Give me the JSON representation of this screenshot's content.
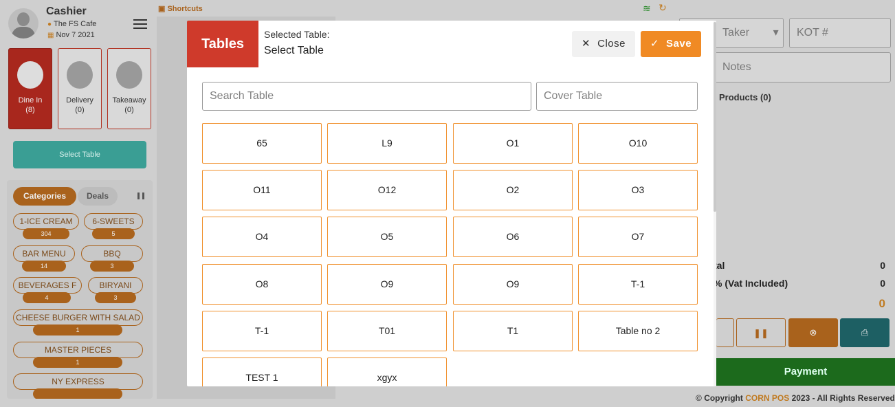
{
  "cashier": {
    "name": "Cashier",
    "location": "The FS Cafe",
    "date": "Nov 7 2021"
  },
  "order_types": [
    {
      "label": "Dine In",
      "count": "(8)"
    },
    {
      "label": "Delivery",
      "count": "(0)"
    },
    {
      "label": "Takeaway",
      "count": "(0)"
    }
  ],
  "select_table_label": "Select Table",
  "category_tabs": {
    "categories": "Categories",
    "deals": "Deals"
  },
  "categories": [
    {
      "name": "1-ICE CREAM",
      "count": "304"
    },
    {
      "name": "6-SWEETS",
      "count": "5"
    },
    {
      "name": "BAR MENU",
      "count": "14"
    },
    {
      "name": "BBQ",
      "count": "3"
    },
    {
      "name": "BEVERAGES F",
      "count": "4"
    },
    {
      "name": "BIRYANI",
      "count": "3"
    },
    {
      "name": "CHEESE BURGER WITH SALAD",
      "count": "1"
    },
    {
      "name": "MASTER PIECES",
      "count": "1"
    },
    {
      "name": "NY EXPRESS",
      "count": ""
    }
  ],
  "shortcuts_label": "Shortcuts",
  "right_panel": {
    "taker": "Taker",
    "kot_placeholder": "KOT #",
    "notes": "Notes",
    "products": "Products (0)",
    "totals": [
      {
        "label": "tal",
        "value": "0"
      },
      {
        "label": "% (Vat Included)",
        "value": "0"
      },
      {
        "label": "",
        "value": "0"
      }
    ],
    "payment": "Payment",
    "copyright_prefix": "Copyright",
    "copyright_brand": "CORN POS",
    "copyright_suffix": "2023 - All Rights Reserved"
  },
  "modal": {
    "title": "Tables",
    "selected_label": "Selected Table:",
    "selected_value": "Select Table",
    "close": "Close",
    "save": "Save",
    "search_placeholder": "Search Table",
    "cover_placeholder": "Cover Table",
    "tables": [
      "65",
      "L9",
      "O1",
      "O10",
      "O11",
      "O12",
      "O2",
      "O3",
      "O4",
      "O5",
      "O6",
      "O7",
      "O8",
      "O9",
      "O9",
      "T-1",
      "T-1",
      "T01",
      "T1",
      "Table no 2",
      "TEST 1",
      "xgyx"
    ]
  },
  "colors": {
    "accent": "#f08a24",
    "title_red": "#cf3a2b",
    "payment_green": "#1c6a1c",
    "teal": "#3a9e94"
  }
}
